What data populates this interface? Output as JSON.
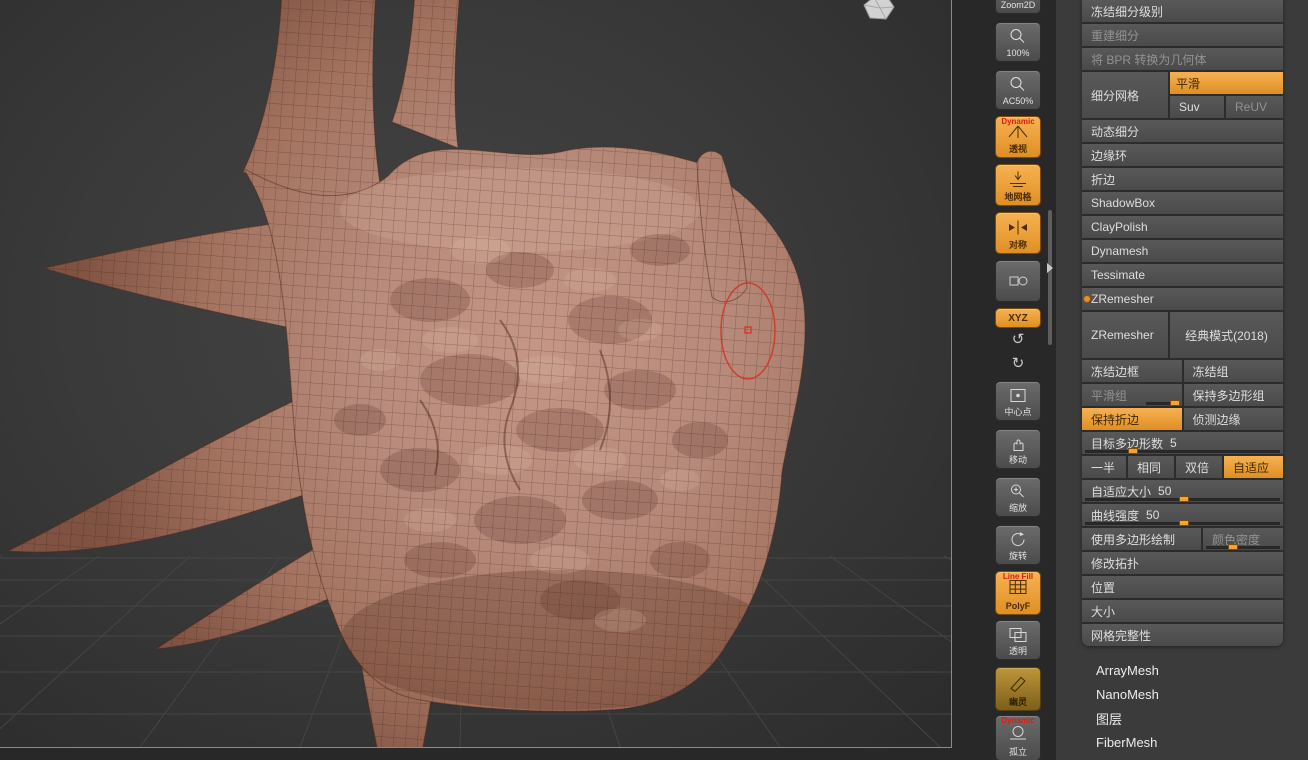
{
  "toolbar": {
    "buttons": [
      {
        "label": "Zoom2D"
      },
      {
        "label": "100%"
      },
      {
        "label": "AC50%"
      },
      {
        "overlay": "Dynamic",
        "label": "透视"
      },
      {
        "label": "地网格"
      },
      {
        "label": "对称"
      },
      {
        "label": ""
      },
      {
        "label": "XYZ"
      },
      {
        "label": "中心点"
      },
      {
        "label": "移动"
      },
      {
        "label": "缩放"
      },
      {
        "label": "旋转"
      },
      {
        "overlay": "Line Fill",
        "label": "PolyF"
      },
      {
        "label": "透明"
      },
      {
        "label": "幽灵"
      },
      {
        "overlay": "Dynamic",
        "label": "孤立"
      }
    ]
  },
  "panel": {
    "freeze_subdiv_levels": "冻结细分级别",
    "reconstruct_subdiv": "重建细分",
    "convert_bpr": "将 BPR 转换为几何体",
    "divide": "细分网格",
    "smt": "平滑",
    "suv": "Suv",
    "reuv": "ReUV",
    "sections": [
      "动态细分",
      "边缘环",
      "折边",
      "ShadowBox",
      "ClayPolish",
      "Dynamesh",
      "Tessimate"
    ],
    "zremesher": {
      "header": "ZRemesher",
      "main": "ZRemesher",
      "legacy": "经典模式(2018)",
      "freeze_border": "冻结边框",
      "freeze_groups": "冻结组",
      "smooth_groups": "平滑组",
      "keep_groups": "保持多边形组",
      "keep_creases": "保持折边",
      "detect_edges": "侦测边缘",
      "target_label": "目标多边形数",
      "target_value": "5",
      "half": "一半",
      "same": "相同",
      "double": "双倍",
      "adapt": "自适应",
      "adaptive_size_label": "自适应大小",
      "adaptive_size_value": "50",
      "curve_strength_label": "曲线强度",
      "curve_strength_value": "50",
      "use_polypaint": "使用多边形绘制",
      "color_density": "颜色密度",
      "modify_topology": "修改拓扑",
      "position": "位置",
      "size": "大小",
      "mesh_integrity": "网格完整性"
    },
    "below": [
      "ArrayMesh",
      "NanoMesh",
      "图层",
      "FiberMesh"
    ]
  },
  "colors": {
    "accent": "#f2a437",
    "mesh": "#b5887a",
    "cursor": "#d23b28"
  }
}
